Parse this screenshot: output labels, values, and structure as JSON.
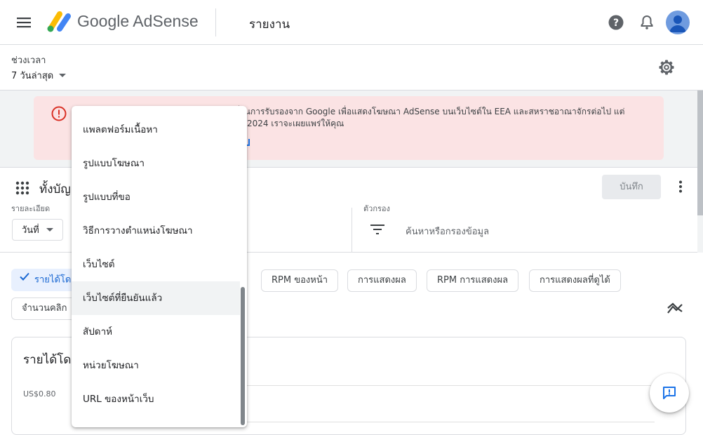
{
  "header": {
    "brand": "Google AdSense",
    "page_title": "รายงาน"
  },
  "date_range": {
    "label": "ช่วงเวลา",
    "value": "7 วันล่าสุด"
  },
  "alert": {
    "line1": "่านการรับรองจาก Google เพื่อแสดงโฆษณา AdSense บนเว็บไซต์ใน EEA และสหราชอาณาจักรต่อไป แต่",
    "line2": "2024 เราจะเผยแพร่ให้คุณ"
  },
  "report": {
    "title_partial": "ทั้งบัญ",
    "save_label": "บันทึก",
    "breakdown_label": "รายละเอียด",
    "breakdown_value": "วันที่",
    "filter_label": "ตัวกรอง",
    "filter_placeholder": "ค้นหาหรือกรองข้อมูล"
  },
  "metrics": {
    "chips": [
      "รายได้โด",
      "RPM ของหน้า",
      "การแสดงผล",
      "RPM การแสดงผล",
      "การแสดงผลที่ดูได้",
      "จำนวนคลิก"
    ]
  },
  "chart_card": {
    "title_partial": "รายได้โด",
    "y_tick": "US$0.80"
  },
  "dropdown": {
    "items": [
      "แพลตฟอร์มเนื้อหา",
      "รูปแบบโฆษณา",
      "รูปแบบที่ขอ",
      "วิธีการวางตำแหน่งโฆษณา",
      "เว็บไซต์",
      "เว็บไซต์ที่ยืนยันแล้ว",
      "สัปดาห์",
      "หน่วยโฆษณา",
      "URL ของหน้าเว็บ"
    ],
    "highlighted_index": 5
  },
  "colors": {
    "accent_blue": "#1a73e8",
    "error_red": "#d93025",
    "alert_bg": "#fbe3e4",
    "selected_chip_bg": "#e8f0fe"
  }
}
